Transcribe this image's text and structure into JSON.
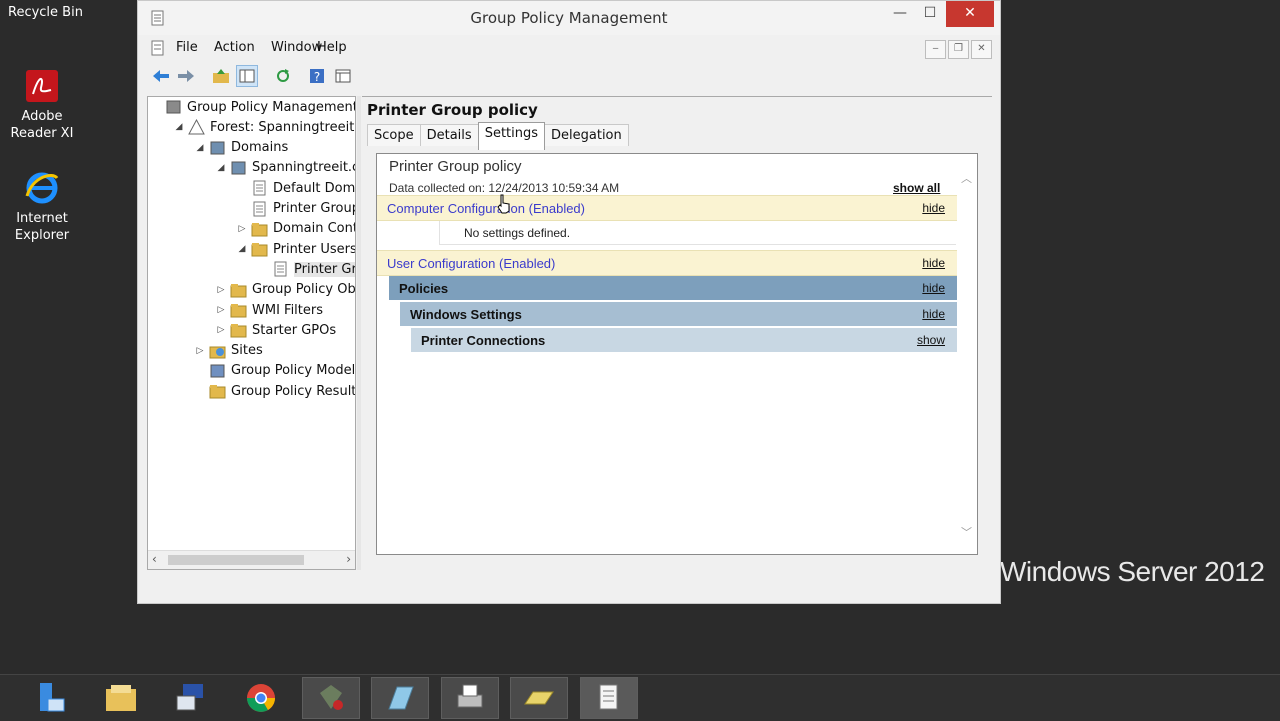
{
  "desktop": {
    "recycle_bin": "Recycle Bin",
    "icons": [
      {
        "label_line1": "Adobe",
        "label_line2": "Reader XI",
        "icon": "adobe-reader-icon"
      },
      {
        "label_line1": "Internet",
        "label_line2": "Explorer",
        "icon": "internet-explorer-icon"
      }
    ],
    "watermark": "Windows Server 2012"
  },
  "window": {
    "title": "Group Policy Management",
    "menu": [
      "File",
      "Action",
      "Window",
      "Help"
    ],
    "controls": {
      "minimize": "—",
      "maximize": "☐",
      "close": "✕"
    },
    "mdi_controls": [
      "‒",
      "❐",
      "✕"
    ]
  },
  "toolbar": {
    "buttons": [
      "back-arrow-icon",
      "forward-arrow-icon",
      "up-folder-icon",
      "show-hide-tree-icon",
      "refresh-icon",
      "help-icon",
      "properties-icon"
    ]
  },
  "tree": {
    "nodes": [
      {
        "label": "Group Policy Management",
        "icon": "gpm-icon",
        "expander": ""
      },
      {
        "label": "Forest: Spanningtreeit.com",
        "icon": "forest-icon",
        "expander": "◢"
      },
      {
        "label": "Domains",
        "icon": "domains-icon",
        "expander": "◢"
      },
      {
        "label": "Spanningtreeit.com",
        "icon": "domain-icon",
        "expander": "◢"
      },
      {
        "label": "Default Domain Policy",
        "icon": "gpo-link-icon",
        "expander": ""
      },
      {
        "label": "Printer Group policy",
        "icon": "gpo-link-icon",
        "expander": ""
      },
      {
        "label": "Domain Controllers",
        "icon": "ou-folder-icon",
        "expander": "▷"
      },
      {
        "label": "Printer Users",
        "icon": "ou-folder-icon",
        "expander": "◢"
      },
      {
        "label": "Printer Group policy",
        "icon": "gpo-link-icon",
        "expander": ""
      },
      {
        "label": "Group Policy Objects",
        "icon": "folder-icon",
        "expander": "▷"
      },
      {
        "label": "WMI Filters",
        "icon": "folder-icon",
        "expander": "▷"
      },
      {
        "label": "Starter GPOs",
        "icon": "folder-icon",
        "expander": "▷"
      },
      {
        "label": "Sites",
        "icon": "sites-icon",
        "expander": "▷"
      },
      {
        "label": "Group Policy Modeling",
        "icon": "modeling-icon",
        "expander": ""
      },
      {
        "label": "Group Policy Results",
        "icon": "results-icon",
        "expander": ""
      }
    ]
  },
  "content": {
    "title": "Printer Group policy",
    "tabs": [
      "Scope",
      "Details",
      "Settings",
      "Delegation"
    ],
    "active_tab": "Settings",
    "report": {
      "title": "Printer Group policy",
      "data_collected": "Data collected on: 12/24/2013 10:59:34 AM",
      "show_all": "show all",
      "computer_config": {
        "label": "Computer Configuration (Enabled)",
        "action": "hide",
        "note": "No settings defined."
      },
      "user_config": {
        "label": "User Configuration (Enabled)",
        "action": "hide"
      },
      "policies": {
        "label": "Policies",
        "action": "hide"
      },
      "windows_settings": {
        "label": "Windows Settings",
        "action": "hide"
      },
      "printer_connections": {
        "label": "Printer Connections",
        "action": "show"
      }
    }
  },
  "taskbar": {
    "items": [
      "server-manager-icon",
      "file-explorer-icon",
      "network-remote-icon",
      "chrome-icon",
      "gpo-editor-icon",
      "notepad-icon",
      "print-management-icon",
      "gpo-folder-icon",
      "group-policy-management-icon"
    ]
  },
  "colors": {
    "config_band": "#faf3d2",
    "config_text": "#3b3bcc",
    "level1": "#7d9fbc",
    "level2": "#a6bed2",
    "level3": "#c8d7e3",
    "close_button": "#c7372f"
  }
}
